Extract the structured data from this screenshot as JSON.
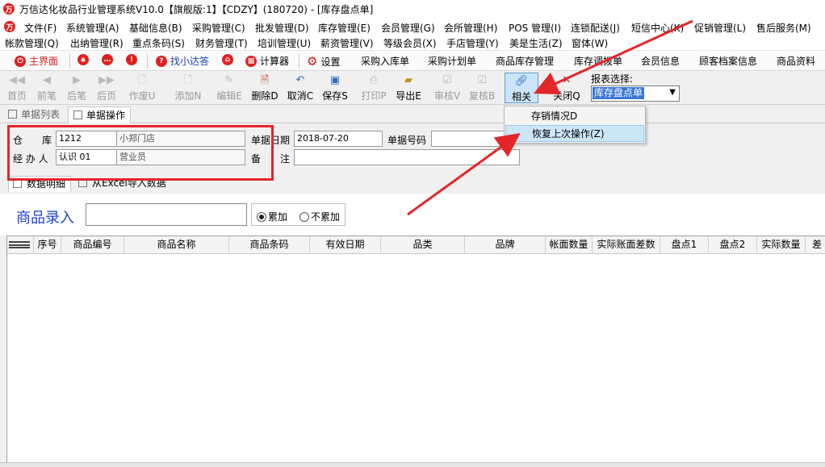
{
  "window": {
    "title": "万信达化妆品行业管理系统V10.0【旗舰版:1】【CDZY】(180720) - [库存盘点单]"
  },
  "menubar": {
    "row1": [
      "文件(F)",
      "系统管理(A)",
      "基础信息(B)",
      "采购管理(C)",
      "批发管理(D)",
      "库存管理(E)",
      "会员管理(G)",
      "会所管理(H)",
      "POS 管理(I)",
      "连锁配送(J)",
      "短信中心(K)",
      "促销管理(L)",
      "售后服务(M)"
    ],
    "row2": [
      "帐款管理(Q)",
      "出纳管理(R)",
      "重点条码(S)",
      "财务管理(T)",
      "培训管理(U)",
      "薪资管理(V)",
      "等级会员(X)",
      "手店管理(Y)",
      "美是生活(Z)",
      "窗体(W)"
    ]
  },
  "quickbar": {
    "home": "主界面",
    "find": "找小达答",
    "calculator": "计算器",
    "settings": "设置",
    "links": [
      "采购入库单",
      "采购计划单",
      "商品库存管理",
      "库存调拨单",
      "会员信息",
      "顾客档案信息",
      "商品资料"
    ]
  },
  "toolbar": {
    "buttons": [
      {
        "label": "首页",
        "enabled": false
      },
      {
        "label": "前笔",
        "enabled": false
      },
      {
        "label": "后笔",
        "enabled": false
      },
      {
        "label": "后页",
        "enabled": false
      },
      {
        "label": "作废U",
        "enabled": false
      },
      {
        "label": "添加N",
        "enabled": false
      },
      {
        "label": "编辑E",
        "enabled": false
      },
      {
        "label": "删除D",
        "enabled": true
      },
      {
        "label": "取消C",
        "enabled": true
      },
      {
        "label": "保存S",
        "enabled": true
      },
      {
        "label": "打印P",
        "enabled": false
      },
      {
        "label": "导出E",
        "enabled": true
      },
      {
        "label": "审核V",
        "enabled": false
      },
      {
        "label": "复核B",
        "enabled": false
      },
      {
        "label": "相关",
        "enabled": true
      },
      {
        "label": "关闭Q",
        "enabled": true
      }
    ],
    "report_label": "报表选择:",
    "report_value": "库存盘点单"
  },
  "related_menu": {
    "items": [
      "存销情况D",
      "恢复上次操作(Z)"
    ],
    "highlighted_index": 1
  },
  "tabs": {
    "list": "单据列表",
    "operation": "单据操作"
  },
  "form": {
    "warehouse_label": "仓　　库",
    "warehouse_code": "1212",
    "warehouse_name": "小郑门店",
    "handler_label": "经 办 人",
    "handler_code": "认识 01",
    "handler_name": "营业员",
    "date_label": "单据日期",
    "date_value": "2018-07-20",
    "number_label": "单据号码",
    "number_value": "",
    "remark_label": "备　　注",
    "remark_value": ""
  },
  "subtabs": {
    "detail": "数据明细",
    "import": "从Excel导入数据"
  },
  "entry": {
    "label": "商品录入",
    "value": "",
    "accumulate": "累加",
    "no_accumulate": "不累加",
    "accumulate_selected": true
  },
  "grid": {
    "columns": [
      "序号",
      "商品编号",
      "商品名称",
      "商品条码",
      "有效日期",
      "品类",
      "品牌",
      "帐面数量",
      "实际账面差数",
      "盘点1",
      "盘点2",
      "实际数量",
      "差"
    ]
  },
  "colors": {
    "highlight_border": "#e3262a",
    "annotation_arrow": "#e3262a",
    "entry_label": "#1a3fd6",
    "selection": "#cce4f7"
  }
}
